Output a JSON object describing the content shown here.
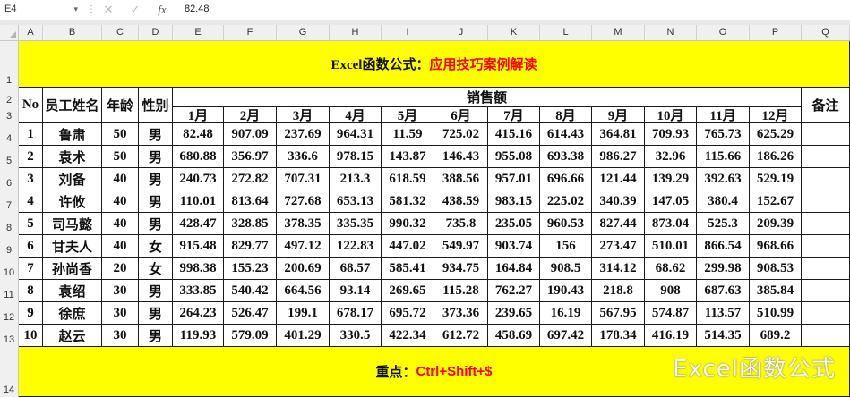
{
  "formula_bar": {
    "name_box": "E4",
    "cancel_icon": "✕",
    "enter_icon": "✓",
    "fx_label": "fx",
    "formula_value": "82.48"
  },
  "columns": [
    "A",
    "B",
    "C",
    "D",
    "E",
    "F",
    "G",
    "H",
    "I",
    "J",
    "K",
    "L",
    "M",
    "N",
    "O",
    "P",
    "Q"
  ],
  "rows": [
    "1",
    "2",
    "3",
    "4",
    "5",
    "6",
    "7",
    "8",
    "9",
    "10",
    "11",
    "12",
    "13",
    "14"
  ],
  "title": {
    "black": "Excel函数公式：",
    "red": "应用技巧案例解读"
  },
  "headers": {
    "no": "No",
    "name": "员工姓名",
    "age": "年龄",
    "gender": "性别",
    "sales": "销售额",
    "note": "备注",
    "months": [
      "1月",
      "2月",
      "3月",
      "4月",
      "5月",
      "6月",
      "7月",
      "8月",
      "9月",
      "10月",
      "11月",
      "12月"
    ]
  },
  "records": [
    [
      "1",
      "鲁肃",
      "50",
      "男",
      "82.48",
      "907.09",
      "237.69",
      "964.31",
      "11.59",
      "725.02",
      "415.16",
      "614.43",
      "364.81",
      "709.93",
      "765.73",
      "625.29"
    ],
    [
      "2",
      "袁术",
      "50",
      "男",
      "680.88",
      "356.97",
      "336.6",
      "978.15",
      "143.87",
      "146.43",
      "955.08",
      "693.38",
      "986.27",
      "32.96",
      "115.66",
      "186.26"
    ],
    [
      "3",
      "刘备",
      "40",
      "男",
      "240.73",
      "272.82",
      "707.31",
      "213.3",
      "618.59",
      "388.56",
      "957.01",
      "696.66",
      "121.44",
      "139.29",
      "392.63",
      "529.19"
    ],
    [
      "4",
      "许攸",
      "40",
      "男",
      "110.01",
      "813.64",
      "727.68",
      "653.13",
      "581.32",
      "438.59",
      "983.15",
      "225.02",
      "340.39",
      "147.05",
      "380.4",
      "152.67"
    ],
    [
      "5",
      "司马懿",
      "40",
      "男",
      "428.47",
      "328.85",
      "378.35",
      "335.35",
      "990.32",
      "735.8",
      "235.05",
      "960.53",
      "827.44",
      "873.04",
      "525.3",
      "209.39"
    ],
    [
      "6",
      "甘夫人",
      "40",
      "女",
      "915.48",
      "829.77",
      "497.12",
      "122.83",
      "447.02",
      "549.97",
      "903.74",
      "156",
      "273.47",
      "510.01",
      "866.54",
      "968.66"
    ],
    [
      "7",
      "孙尚香",
      "20",
      "女",
      "998.38",
      "155.23",
      "200.69",
      "68.57",
      "585.41",
      "934.75",
      "164.84",
      "908.5",
      "314.12",
      "68.62",
      "299.98",
      "908.53"
    ],
    [
      "8",
      "袁绍",
      "30",
      "男",
      "333.85",
      "540.42",
      "664.56",
      "93.14",
      "269.65",
      "115.28",
      "762.27",
      "190.43",
      "218.8",
      "908",
      "687.63",
      "385.84"
    ],
    [
      "9",
      "徐庶",
      "30",
      "男",
      "264.23",
      "526.47",
      "199.1",
      "678.17",
      "695.72",
      "373.36",
      "239.65",
      "16.19",
      "567.95",
      "574.87",
      "113.57",
      "510.99"
    ],
    [
      "10",
      "赵云",
      "30",
      "男",
      "119.93",
      "579.09",
      "401.29",
      "330.5",
      "422.34",
      "612.72",
      "458.69",
      "697.42",
      "178.34",
      "416.19",
      "514.35",
      "689.2"
    ]
  ],
  "footer": {
    "black": "重点：",
    "red": "Ctrl+Shift+$"
  },
  "watermark": "Excel函数公式",
  "colors": {
    "title_fill": "#ffff00",
    "accent_red": "#ff0000",
    "header_gray": "#f0f0f0"
  }
}
